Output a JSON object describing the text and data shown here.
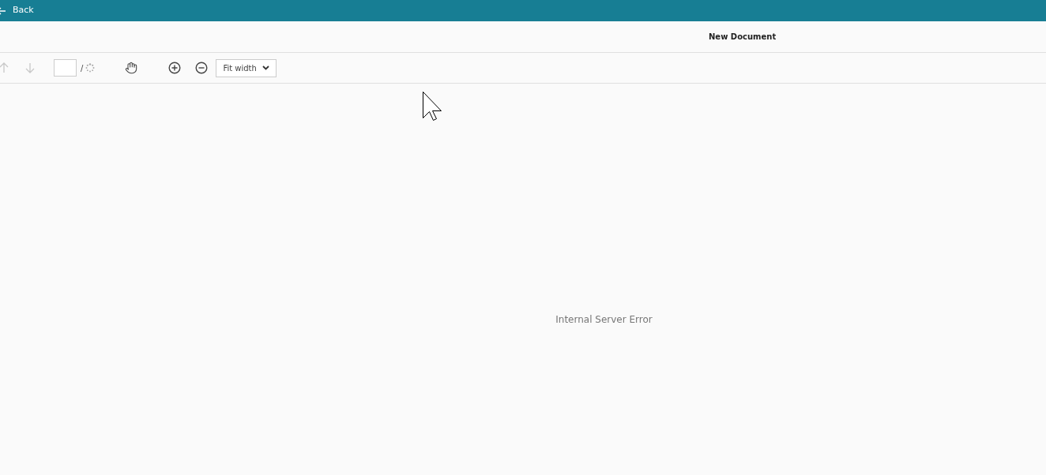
{
  "header": {
    "back_label": "Back"
  },
  "document": {
    "title": "New Document"
  },
  "toolbar": {
    "previous_disabled": true,
    "next_disabled": true,
    "separator": "/",
    "zoom_mode": "Fit width"
  },
  "content": {
    "message": "Internal Server Error"
  }
}
